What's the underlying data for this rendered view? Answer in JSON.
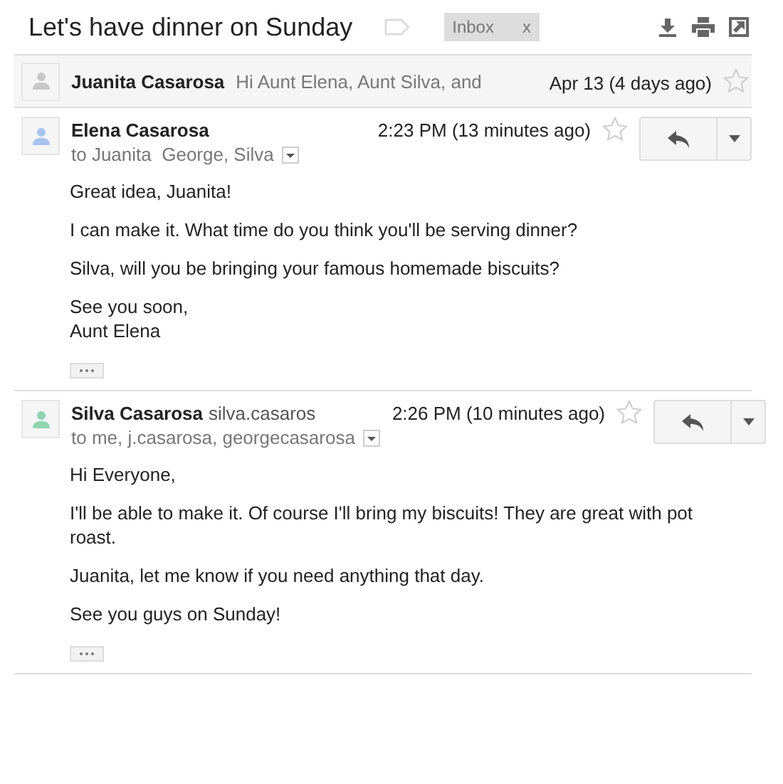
{
  "subject": "Let's have dinner on Sunday",
  "labels": [
    {
      "name": "Inbox",
      "remove": "x"
    }
  ],
  "messages": [
    {
      "kind": "collapsed",
      "sender": "Juanita Casarosa",
      "snippet": "Hi Aunt Elena, Aunt Silva, and",
      "date": "Apr 13 (4 days ago)",
      "starred": false,
      "color": "#c8c8c8"
    },
    {
      "kind": "expanded",
      "sender": "Elena Casarosa",
      "date": "2:23 PM (13 minutes ago)",
      "starred": false,
      "color": "#a8c4f0",
      "recipients": "to Juanita  George, Silva",
      "paragraphs": [
        "Great idea, Juanita!",
        "I can make it. What time do you think you'll be serving dinner?",
        "Silva, will you be bringing your famous homemade biscuits?",
        "See you soon,\nAunt Elena"
      ]
    },
    {
      "kind": "expanded",
      "sender": "Silva Casarosa",
      "email": "silva.casaros",
      "date": "2:26 PM (10 minutes ago)",
      "starred": false,
      "color": "#8ed4b0",
      "recipients": "to me, j.casarosa, georgecasarosa",
      "paragraphs": [
        "Hi Everyone,",
        "I'll be able to make it. Of course I'll bring my biscuits! They are great with pot roast.",
        "Juanita, let me know if you need anything that day.",
        "See you guys on Sunday!"
      ]
    }
  ]
}
